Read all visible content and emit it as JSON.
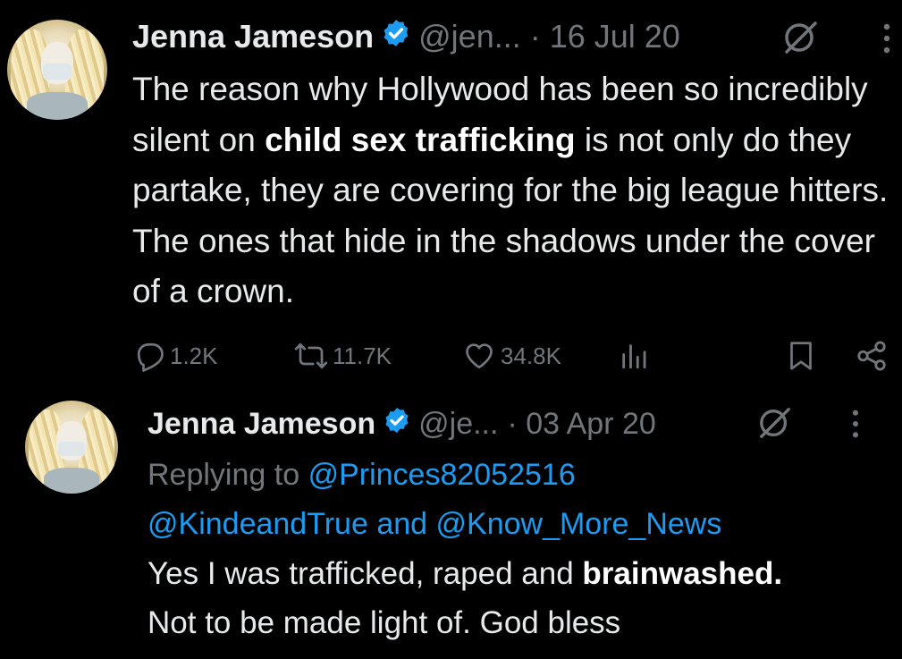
{
  "tweet1": {
    "name": "Jenna Jameson",
    "handle": "@jen...",
    "date": "· 16 Jul 20",
    "text_parts": [
      "The reason why Hollywood has been so incredibly silent on ",
      "child sex trafficking",
      " is not only do they partake, they are covering for the big league hitters. The ones that hide in the shadows under the cover of a crown."
    ],
    "stats": {
      "replies": "1.2K",
      "reposts": "11.7K",
      "likes": "34.8K"
    },
    "icons": [
      "verified-badge-icon",
      "grok-icon",
      "more-icon",
      "reply-icon",
      "repost-icon",
      "like-icon",
      "views-icon",
      "bookmark-icon",
      "share-icon"
    ]
  },
  "tweet2": {
    "name": "Jenna Jameson",
    "handle": "@je...",
    "date": "· 03 Apr 20",
    "replying_prefix": "Replying to",
    "mention1": "@Princes82052516",
    "mention2": "@KindeandTrue",
    "and_word": "and",
    "mention3": "@Know_More_News",
    "text_part1": "Yes I was trafficked, raped and ",
    "text_bold": "brainwashed.",
    "text_part2": "Not to be made light of. God bless"
  },
  "colors": {
    "background": "#000000",
    "text": "#e7e9ea",
    "muted": "#71767b",
    "accent": "#1d9bf0"
  }
}
